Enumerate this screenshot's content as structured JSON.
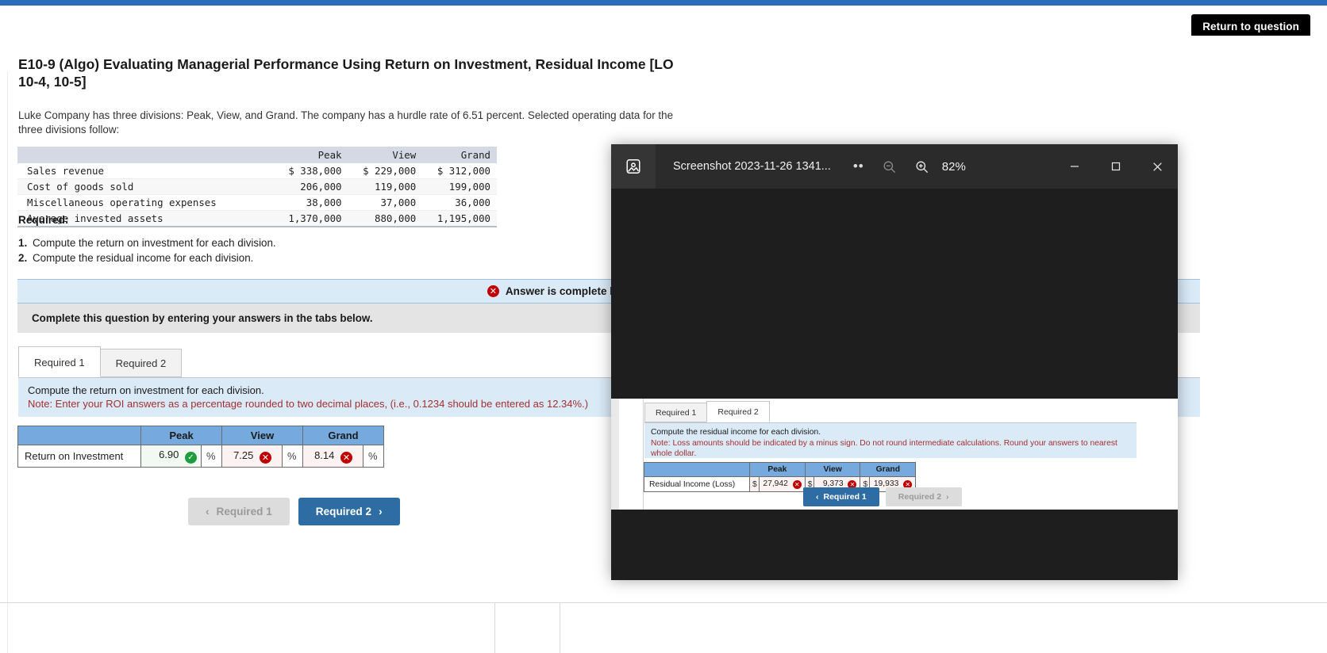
{
  "topbar": {
    "return_button": "Return to question"
  },
  "question": {
    "title": "E10-9 (Algo) Evaluating Managerial Performance Using Return on Investment, Residual Income [LO 10-4, 10-5]",
    "intro": "Luke Company has three divisions: Peak, View, and Grand. The company has a hurdle rate of 6.51 percent. Selected operating data for the three divisions follow:",
    "required_heading": "Required:",
    "required_items": [
      {
        "num": "1.",
        "text": "Compute the return on investment for each division."
      },
      {
        "num": "2.",
        "text": "Compute the residual income for each division."
      }
    ]
  },
  "data_table": {
    "columns": [
      "",
      "Peak",
      "View",
      "Grand"
    ],
    "rows": [
      {
        "label": "Sales revenue",
        "peak": "$ 338,000",
        "view": "$ 229,000",
        "grand": "$ 312,000"
      },
      {
        "label": "Cost of goods sold",
        "peak": "206,000",
        "view": "119,000",
        "grand": "199,000"
      },
      {
        "label": "Miscellaneous operating expenses",
        "peak": "38,000",
        "view": "37,000",
        "grand": "36,000"
      },
      {
        "label": "Average invested assets",
        "peak": "1,370,000",
        "view": "880,000",
        "grand": "1,195,000"
      }
    ]
  },
  "answer_banner": {
    "icon": "error-circle-icon",
    "text": "Answer is complete but not entirely correct."
  },
  "complete_bar": {
    "text": "Complete this question by entering your answers in the tabs below."
  },
  "tabs": [
    {
      "label": "Required 1",
      "active": true
    },
    {
      "label": "Required 2",
      "active": false
    }
  ],
  "prompt": {
    "line1": "Compute the return on investment for each division.",
    "line2": "Note: Enter your ROI answers as a percentage rounded to two decimal places, (i.e., 0.1234 should be entered as 12.34%.)"
  },
  "roi_table": {
    "headers": [
      "",
      "Peak",
      "View",
      "Grand"
    ],
    "row_label": "Return on Investment",
    "unit": "%",
    "cells": [
      {
        "value": "6.90",
        "status": "correct",
        "mark": "✓"
      },
      {
        "value": "7.25",
        "status": "incorrect",
        "mark": "✕"
      },
      {
        "value": "8.14",
        "status": "incorrect",
        "mark": "✕"
      }
    ]
  },
  "nav_buttons": {
    "prev_label": "Required 1",
    "prev_icon": "chevron-left-icon",
    "next_label": "Required 2",
    "next_icon": "chevron-right-icon"
  },
  "photo_window": {
    "app_icon": "photos-app-icon",
    "title": "Screenshot 2023-11-26 1341...",
    "more_icon": "more-options-icon",
    "zoom_out_icon": "zoom-out-icon",
    "zoom_in_icon": "zoom-in-icon",
    "zoom_level": "82%",
    "minimize_icon": "minimize-icon",
    "maximize_icon": "maximize-icon",
    "close_icon": "close-icon",
    "inner": {
      "tabs": [
        {
          "label": "Required 1",
          "active": false
        },
        {
          "label": "Required 2",
          "active": true
        }
      ],
      "prompt": {
        "line1": "Compute the residual income for each division.",
        "line2": "Note: Loss amounts should be indicated by a minus sign. Do not round intermediate calculations. Round your answers to nearest whole dollar."
      },
      "table": {
        "headers": [
          "",
          "Peak",
          "View",
          "Grand"
        ],
        "row_label": "Residual Income (Loss)",
        "currency": "$",
        "cells": [
          {
            "value": "27,942",
            "status": "incorrect",
            "mark": "✕"
          },
          {
            "value": "9,373",
            "status": "incorrect",
            "mark": "✕"
          },
          {
            "value": "19,933",
            "status": "incorrect",
            "mark": "✕"
          }
        ]
      },
      "nav_buttons": {
        "prev_label": "Required 1",
        "prev_icon": "chevron-left-icon",
        "next_label": "Required 2",
        "next_icon": "chevron-right-icon"
      }
    }
  },
  "colors": {
    "accent_blue": "#2a6ebb",
    "table_header_blue": "#76a9dd",
    "info_bg": "#dbeaf7",
    "error_red": "#c00000",
    "success_green": "#1f9d3e",
    "note_red": "#a33030"
  }
}
